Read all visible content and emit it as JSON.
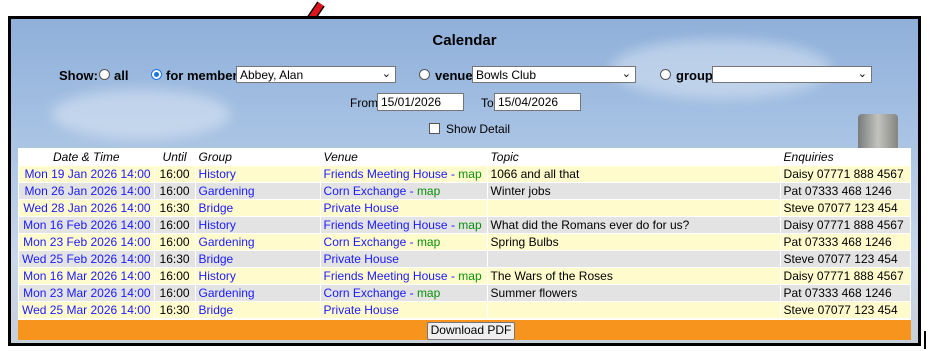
{
  "title": "Calendar",
  "filters": {
    "show_label": "Show:",
    "all_label": "all",
    "member_label": "for member",
    "member_value": "Abbey, Alan",
    "venue_label": "venue",
    "venue_value": "Bowls Club",
    "group_label": "group",
    "group_value": "",
    "selected": "for member"
  },
  "dates": {
    "from_label": "From",
    "from_value": "15/01/2026",
    "to_label": "To",
    "to_value": "15/04/2026"
  },
  "detail_label": "Show Detail",
  "columns": [
    "Date & Time",
    "Until",
    "Group",
    "Venue",
    "Topic",
    "Enquiries"
  ],
  "map_label": "map",
  "rows": [
    {
      "date": "Mon 19 Jan 2026 14:00",
      "until": "16:00",
      "group": "History",
      "venue": "Friends Meeting House",
      "map": true,
      "topic": "1066 and all that",
      "enquiries": "Daisy 07771 888 4567"
    },
    {
      "date": "Mon 26 Jan 2026 14:00",
      "until": "16:00",
      "group": "Gardening",
      "venue": "Corn Exchange",
      "map": true,
      "topic": "Winter jobs",
      "enquiries": "Pat 07333 468 1246"
    },
    {
      "date": "Wed 28 Jan 2026 14:00",
      "until": "16:30",
      "group": "Bridge",
      "venue": "Private House",
      "map": false,
      "topic": "",
      "enquiries": "Steve 07077 123 454"
    },
    {
      "date": "Mon 16 Feb 2026 14:00",
      "until": "16:00",
      "group": "History",
      "venue": "Friends Meeting House",
      "map": true,
      "topic": "What did the Romans ever do for us?",
      "enquiries": "Daisy 07771 888 4567"
    },
    {
      "date": "Mon 23 Feb 2026 14:00",
      "until": "16:00",
      "group": "Gardening",
      "venue": "Corn Exchange",
      "map": true,
      "topic": "Spring Bulbs",
      "enquiries": "Pat 07333 468 1246"
    },
    {
      "date": "Wed 25 Feb 2026 14:00",
      "until": "16:30",
      "group": "Bridge",
      "venue": "Private House",
      "map": false,
      "topic": "",
      "enquiries": "Steve 07077 123 454"
    },
    {
      "date": "Mon 16 Mar 2026 14:00",
      "until": "16:00",
      "group": "History",
      "venue": "Friends Meeting House",
      "map": true,
      "topic": "The Wars of the Roses",
      "enquiries": "Daisy 07771 888 4567"
    },
    {
      "date": "Mon 23 Mar 2026 14:00",
      "until": "16:00",
      "group": "Gardening",
      "venue": "Corn Exchange",
      "map": true,
      "topic": "Summer flowers",
      "enquiries": "Pat 07333 468 1246"
    },
    {
      "date": "Wed 25 Mar 2026 14:00",
      "until": "16:30",
      "group": "Bridge",
      "venue": "Private House",
      "map": false,
      "topic": "",
      "enquiries": "Steve 07077 123 454"
    }
  ],
  "download_label": "Download PDF",
  "colors": {
    "row_yellow": "#fffbcc",
    "row_grey": "#e3e3e3",
    "link_blue": "#1a1aff",
    "map_green": "#0a8f0a",
    "footer_orange": "#f7941d",
    "arrow_red": "#e0141e"
  },
  "icons": {
    "annotation": "red-arrow-icon",
    "dropdown": "chevron-down-icon"
  }
}
